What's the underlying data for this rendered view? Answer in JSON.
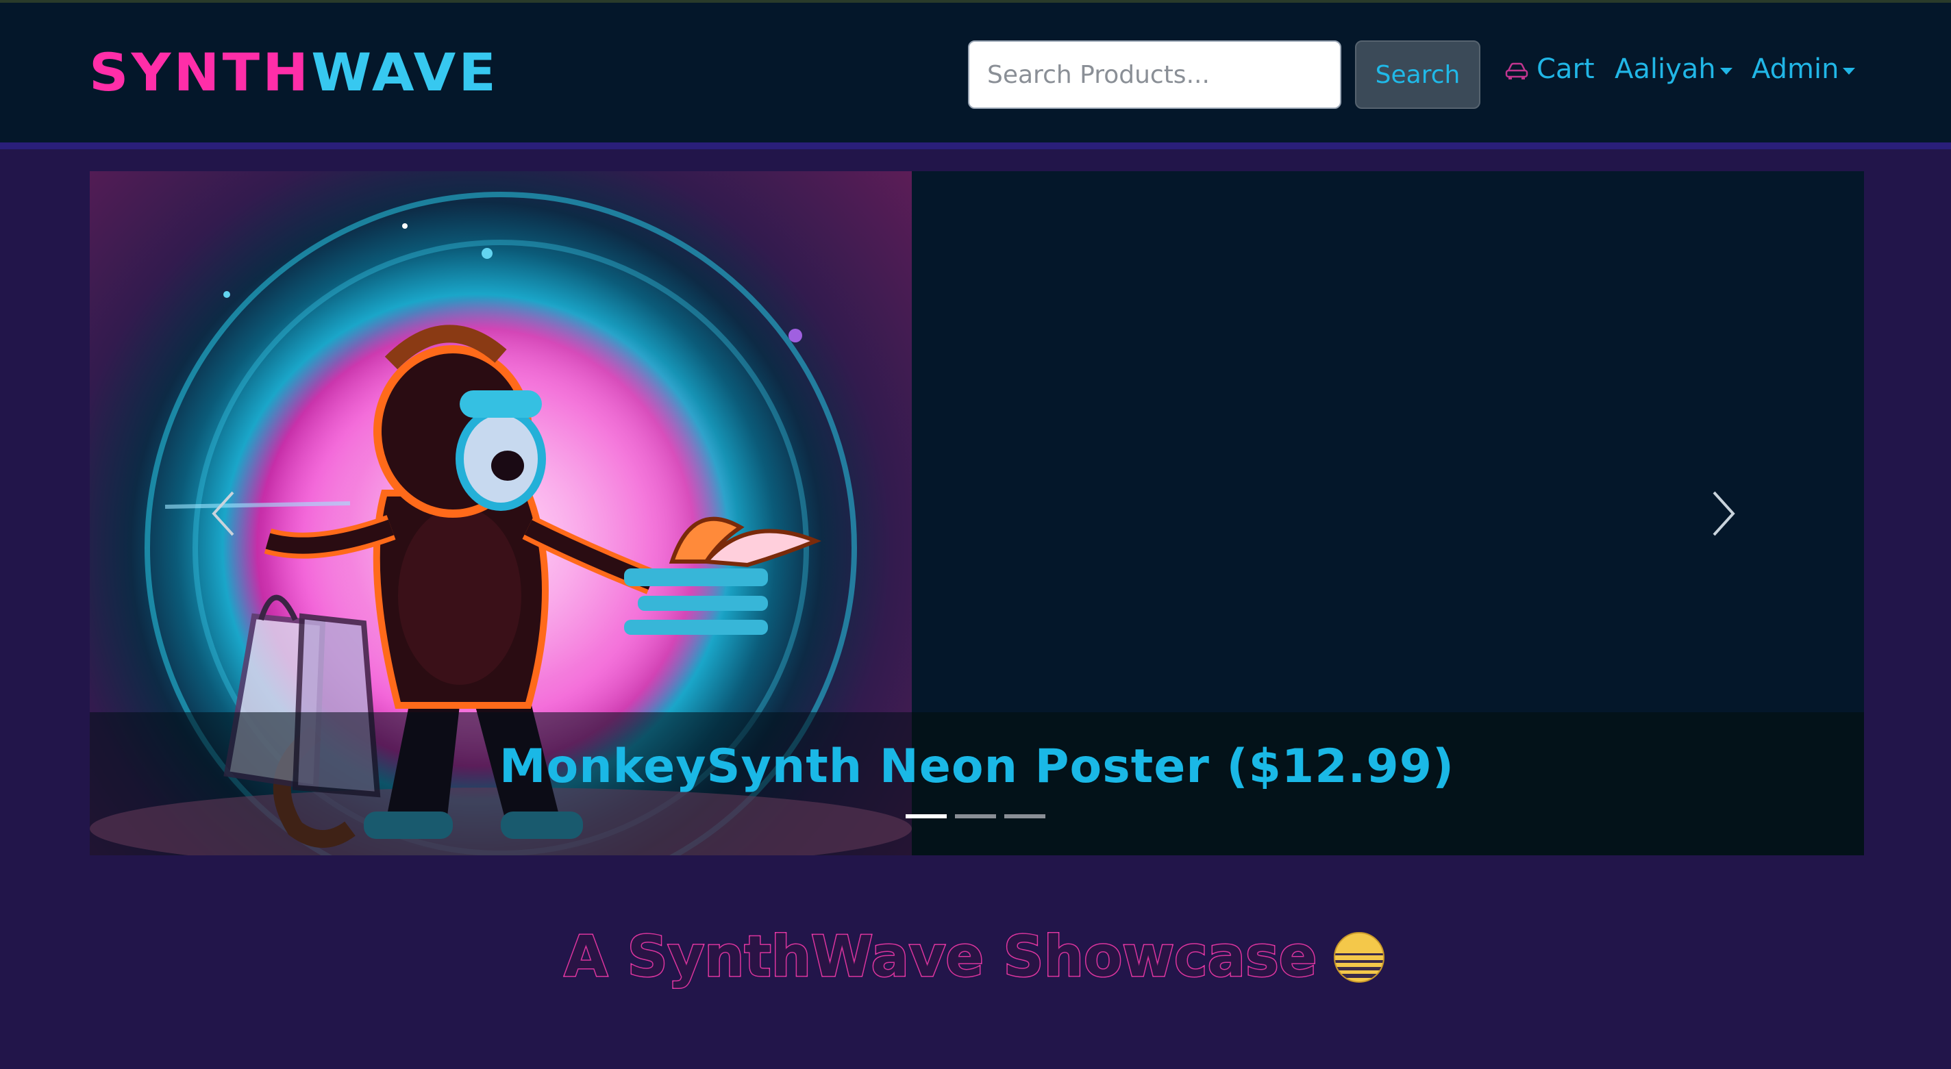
{
  "brand": {
    "part1": "SYNTH",
    "part2": "WAVE"
  },
  "search": {
    "placeholder": "Search Products...",
    "button_label": "Search"
  },
  "nav": {
    "cart_label": "Cart",
    "cart_icon": "car-icon",
    "user_label": "Aaliyah",
    "admin_label": "Admin"
  },
  "carousel": {
    "caption": "MonkeySynth Neon Poster ($12.99)",
    "indicators": 3,
    "active_index": 0,
    "prev_icon": "chevron-left-icon",
    "next_icon": "chevron-right-icon"
  },
  "showcase": {
    "heading": "A SynthWave Showcase",
    "icon": "sunset-icon"
  },
  "colors": {
    "navbar_bg": "#04172a",
    "page_bg": "#22154a",
    "accent_cyan": "#21b6e6",
    "accent_pink": "#ff2ea8"
  }
}
